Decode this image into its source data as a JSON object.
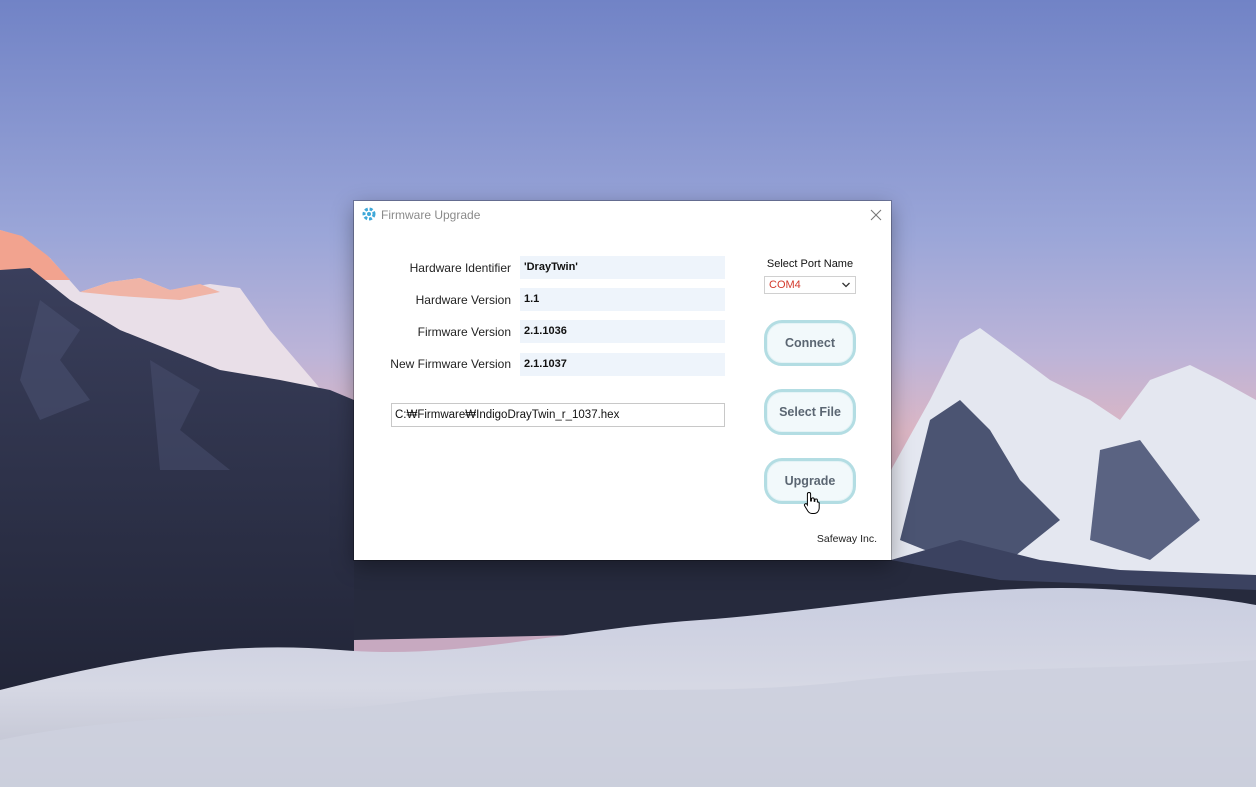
{
  "window": {
    "title": "Firmware Upgrade",
    "close_glyph": "✕"
  },
  "fields": {
    "hardware_identifier": {
      "label": "Hardware Identifier",
      "value": "'DrayTwin'"
    },
    "hardware_version": {
      "label": "Hardware Version",
      "value": "1.1"
    },
    "firmware_version": {
      "label": "Firmware Version",
      "value": "2.1.1036"
    },
    "new_firmware_version": {
      "label": "New Firmware Version",
      "value": "2.1.1037"
    }
  },
  "file_path": "C:₩Firmware₩IndigoDrayTwin_r_1037.hex",
  "port": {
    "label": "Select Port Name",
    "selected": "COM4"
  },
  "buttons": {
    "connect": "Connect",
    "select_file": "Select File",
    "upgrade": "Upgrade"
  },
  "footer": "Safeway Inc.",
  "icons": {
    "app": "gear-icon",
    "close": "close-icon",
    "dropdown": "chevron-down-icon",
    "cursor": "hand-pointer-icon"
  },
  "colors": {
    "button_border": "#b3dde3",
    "field_background": "#eef4fb",
    "port_value": "#d33a2c",
    "app_icon": "#3fa8d8"
  }
}
